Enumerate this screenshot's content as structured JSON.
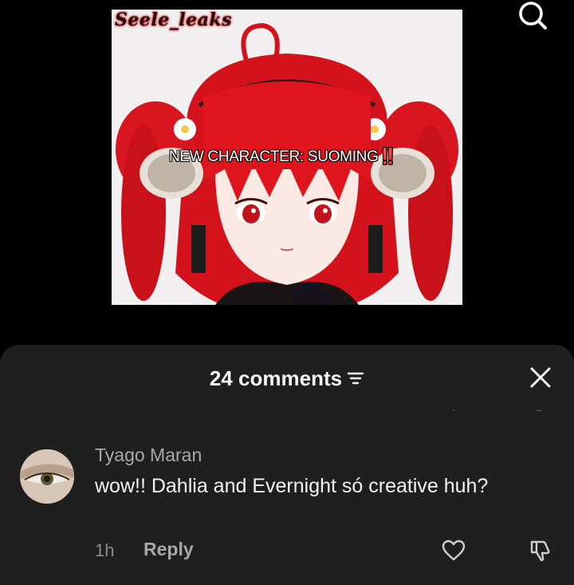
{
  "video": {
    "watermark": "Seele_leaks",
    "overlay_text": "NEW CHARACTER: SUOMING",
    "overlay_emphasis": "‼️",
    "accent_hair": "#e0141c"
  },
  "top_bar": {
    "search_icon": "search-icon"
  },
  "comments_sheet": {
    "title": "24 comments",
    "sort_icon": "sort-icon",
    "close_icon": "close-icon",
    "background": "#1f1f1f"
  },
  "comments": [
    {
      "username": "Tyago Maran",
      "text": "wow!! Dahlia and Evernight só creative huh?",
      "time": "1h",
      "reply_label": "Reply",
      "like_icon": "heart-icon",
      "dislike_icon": "thumbs-down-icon"
    }
  ]
}
